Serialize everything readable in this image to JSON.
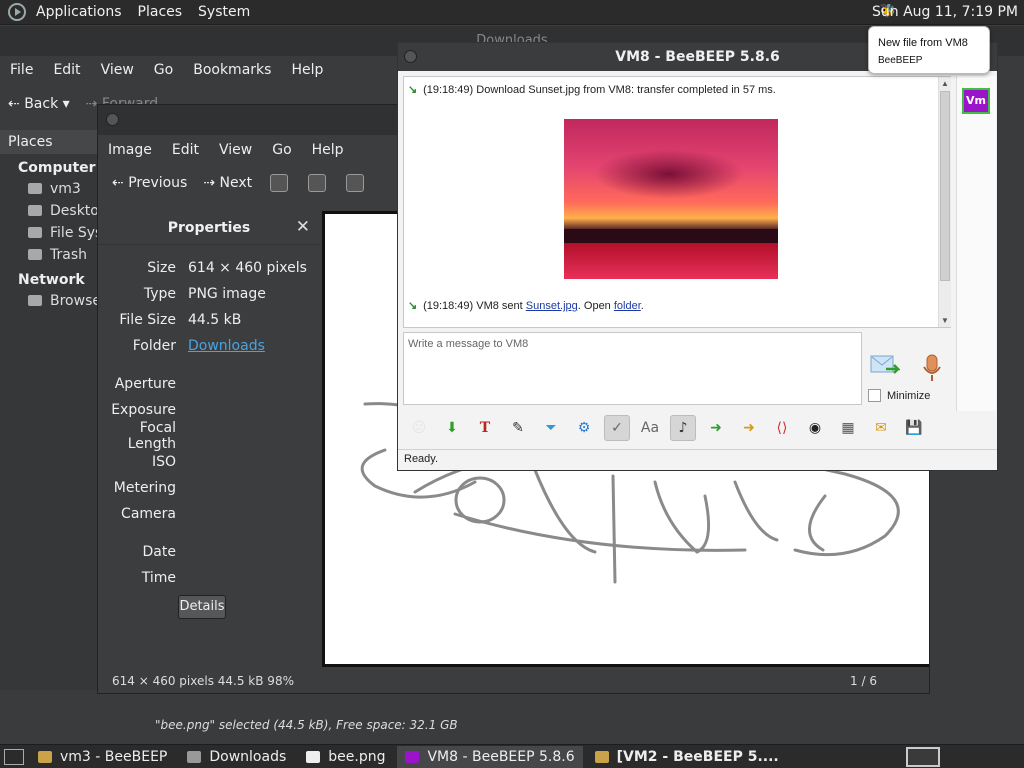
{
  "top_panel": {
    "menus": [
      "Applications",
      "Places",
      "System"
    ],
    "clock": "Sun Aug 11,  7:19 PM"
  },
  "notification": {
    "line1": "New file from VM8",
    "line2": "BeeBEEP"
  },
  "nautilus": {
    "title": "Downloads",
    "menus": [
      "File",
      "Edit",
      "View",
      "Go",
      "Bookmarks",
      "Help"
    ],
    "toolbar": {
      "back": "Back",
      "forward": "Forward"
    },
    "sidebar": {
      "header": "Places",
      "section_computer": "Computer",
      "items_computer": [
        "vm3",
        "Desktop",
        "File System",
        "Trash"
      ],
      "section_network": "Network",
      "items_network": [
        "Browse Network"
      ]
    },
    "status": "\"bee.png\" selected (44.5 kB), Free space: 32.1 GB"
  },
  "eog": {
    "menus": [
      "Image",
      "Edit",
      "View",
      "Go",
      "Help"
    ],
    "toolbar": {
      "previous": "Previous",
      "next": "Next"
    },
    "properties": {
      "title": "Properties",
      "rows1": [
        {
          "key": "Size",
          "value": "614 × 460 pixels"
        },
        {
          "key": "Type",
          "value": "PNG image"
        },
        {
          "key": "File Size",
          "value": "44.5 kB"
        }
      ],
      "folder_key": "Folder",
      "folder_value": "Downloads",
      "rows2": [
        {
          "key": "Aperture",
          "value": ""
        },
        {
          "key": "Exposure",
          "value": ""
        },
        {
          "key": "Focal Length",
          "value": ""
        },
        {
          "key": "ISO",
          "value": ""
        },
        {
          "key": "Metering",
          "value": ""
        },
        {
          "key": "Camera",
          "value": ""
        }
      ],
      "rows3": [
        {
          "key": "Date",
          "value": ""
        },
        {
          "key": "Time",
          "value": ""
        }
      ],
      "details_button": "Details"
    },
    "status_left": "614 × 460 pixels  44.5 kB    98%",
    "status_right": "1 / 6"
  },
  "beebeep": {
    "title": "VM8 - BeeBEEP 5.8.6",
    "line1": "(19:18:49)  Download Sunset.jpg from VM8: transfer completed in 57 ms.",
    "line2_prefix": "(19:18:49)  VM8 sent ",
    "line2_link": "Sunset.jpg",
    "line2_mid": ". Open ",
    "line2_folder": "folder",
    "line2_end": ".",
    "avatar": "Vm",
    "input_placeholder": "Write a message to VM8",
    "minimize": "Minimize",
    "status": "Ready."
  },
  "taskbar": {
    "tasks": [
      "vm3 - BeeBEEP",
      "Downloads",
      "bee.png",
      "VM8 - BeeBEEP 5.8.6",
      "[VM2 - BeeBEEP 5...."
    ]
  }
}
